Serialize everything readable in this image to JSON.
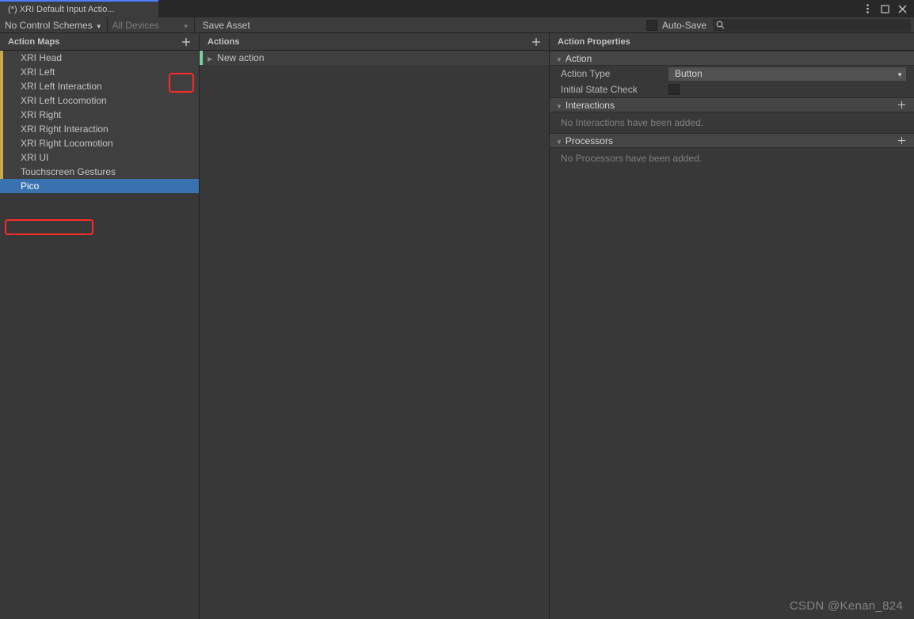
{
  "tab": {
    "title": "(*) XRI Default Input Actio..."
  },
  "toolbar": {
    "control_schemes": "No Control Schemes",
    "devices": "All Devices",
    "save": "Save Asset",
    "autosave": "Auto-Save"
  },
  "actionMaps": {
    "header": "Action Maps",
    "items": [
      {
        "label": "XRI Head"
      },
      {
        "label": "XRI Left"
      },
      {
        "label": "XRI Left Interaction"
      },
      {
        "label": "XRI Left Locomotion"
      },
      {
        "label": "XRI Right"
      },
      {
        "label": "XRI Right Interaction"
      },
      {
        "label": "XRI Right Locomotion"
      },
      {
        "label": "XRI UI"
      },
      {
        "label": "Touchscreen Gestures"
      },
      {
        "label": "Pico",
        "selected": true
      }
    ]
  },
  "actions": {
    "header": "Actions",
    "items": [
      {
        "label": "New action"
      }
    ]
  },
  "properties": {
    "header": "Action Properties",
    "action_section": "Action",
    "action_type_label": "Action Type",
    "action_type_value": "Button",
    "initial_state_label": "Initial State Check",
    "interactions_section": "Interactions",
    "interactions_empty": "No Interactions have been added.",
    "processors_section": "Processors",
    "processors_empty": "No Processors have been added."
  },
  "watermark": "CSDN @Kenan_824"
}
